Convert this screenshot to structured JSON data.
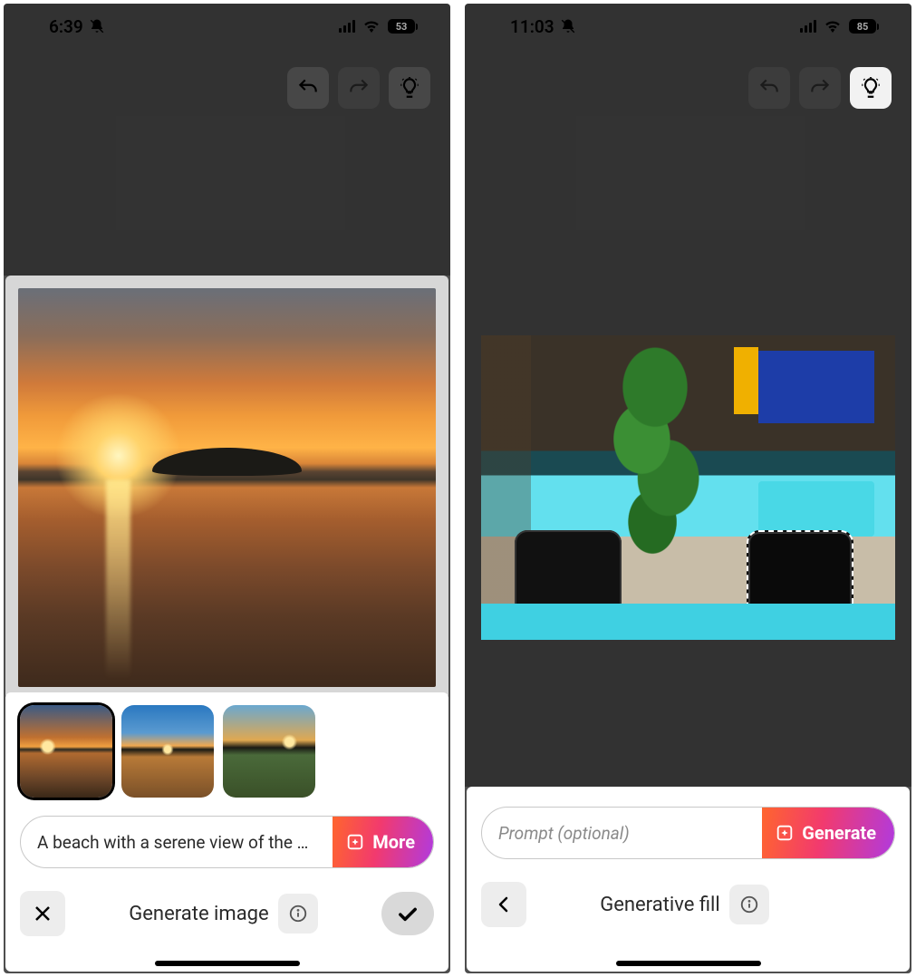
{
  "left": {
    "status": {
      "time": "6:39",
      "battery": "53"
    },
    "toolbar": {
      "undo": "undo",
      "redo": "redo",
      "idea": "idea"
    },
    "prompt_value": "A beach with a serene view of the s...",
    "more_label": "More",
    "title": "Generate image",
    "thumb_count": 3,
    "selected_thumb": 0
  },
  "right": {
    "status": {
      "time": "11:03",
      "battery": "85"
    },
    "toolbar": {
      "undo": "undo",
      "redo": "redo",
      "idea": "idea"
    },
    "prompt_placeholder": "Prompt (optional)",
    "generate_label": "Generate",
    "title": "Generative fill"
  }
}
